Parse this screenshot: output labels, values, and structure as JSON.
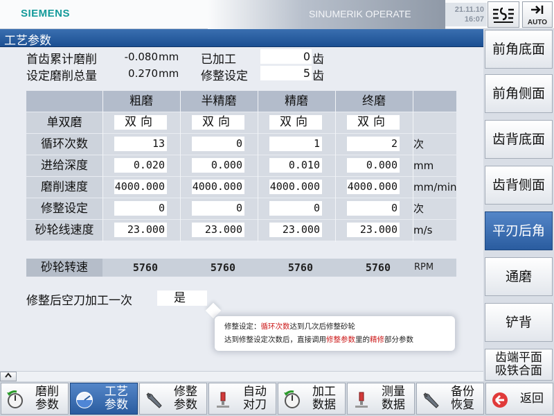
{
  "header": {
    "brand": "SIEMENS",
    "product": "SINUMERIK OPERATE",
    "date": "21.11.10",
    "time": "16:07",
    "auto_label": "AUTO"
  },
  "title": "工艺参数",
  "summary": {
    "cum_grind_label": "首齿累计磨削",
    "cum_grind_value": "-0.080",
    "cum_grind_unit": "mm",
    "total_grind_label": "设定磨削总量",
    "total_grind_value": "0.270",
    "total_grind_unit": "mm",
    "processed_label": "已加工",
    "processed_value": "0",
    "processed_unit": "齿",
    "dress_label": "修整设定",
    "dress_value": "5",
    "dress_unit": "齿"
  },
  "table": {
    "columns": [
      "粗磨",
      "半精磨",
      "精磨",
      "终磨"
    ],
    "rows": [
      {
        "label": "单双磨",
        "values": [
          "双向",
          "双向",
          "双向",
          "双向"
        ],
        "unit": ""
      },
      {
        "label": "循环次数",
        "values": [
          "13",
          "0",
          "1",
          "2"
        ],
        "unit": "次"
      },
      {
        "label": "进给深度",
        "values": [
          "0.020",
          "0.000",
          "0.010",
          "0.000"
        ],
        "unit": "mm"
      },
      {
        "label": "磨削速度",
        "values": [
          "4000.000",
          "4000.000",
          "4000.000",
          "4000.000"
        ],
        "unit": "mm/min"
      },
      {
        "label": "修整设定",
        "values": [
          "0",
          "0",
          "0",
          "0"
        ],
        "unit": "次"
      },
      {
        "label": "砂轮线速度",
        "values": [
          "23.000",
          "23.000",
          "23.000",
          "23.000"
        ],
        "unit": "m/s"
      }
    ]
  },
  "wheel_speed": {
    "label": "砂轮转速",
    "values": [
      "5760",
      "5760",
      "5760",
      "5760"
    ],
    "unit": "RPM"
  },
  "dry_run": {
    "label": "修整后空刀加工一次",
    "value": "是"
  },
  "tooltip": {
    "l1_a": "修整设定：",
    "l1_b": "循环次数",
    "l1_c": "达到几次后修整砂轮",
    "l2_a": "达到修整设定次数后，直接调用",
    "l2_b": "修整参数",
    "l2_c": "里的",
    "l2_d": "精修",
    "l2_e": "部分参数"
  },
  "right_softkeys": [
    "前角底面",
    "前角侧面",
    "齿背底面",
    "齿背侧面",
    "平刃后角",
    "通磨",
    "铲背",
    "齿端平面\n吸铁合面"
  ],
  "right_active_index": 4,
  "bottom_softkeys": [
    {
      "l1": "磨削",
      "l2": "参数",
      "icon": "cycle-icon"
    },
    {
      "l1": "工艺",
      "l2": "参数",
      "icon": "gauge-icon"
    },
    {
      "l1": "修整",
      "l2": "参数",
      "icon": "wrench-icon"
    },
    {
      "l1": "自动",
      "l2": "对刀",
      "icon": "probe-icon"
    },
    {
      "l1": "加工",
      "l2": "数据",
      "icon": "cycle-icon"
    },
    {
      "l1": "测量",
      "l2": "数据",
      "icon": "probe-icon"
    },
    {
      "l1": "备份",
      "l2": "恢复",
      "icon": "wrench-icon"
    },
    {
      "l1": "返回",
      "l2": "",
      "icon": "back-icon"
    }
  ],
  "bottom_active_index": 1,
  "colors": {
    "brand": "#139a9a",
    "title_bar": "#1b4f92",
    "active_key": "#2a5c9f",
    "highlight_red": "#cc1a1a"
  }
}
